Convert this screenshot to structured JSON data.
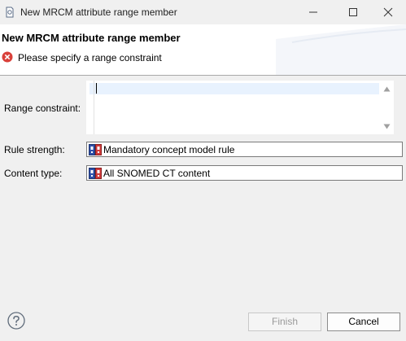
{
  "window": {
    "title": "New MRCM attribute range member",
    "controls": [
      "minimize-icon",
      "maximize-icon",
      "close-icon"
    ]
  },
  "header": {
    "title": "New MRCM attribute range member",
    "message": "Please specify a range constraint",
    "message_icon": "error-icon"
  },
  "form": {
    "range_label": "Range constraint:",
    "range_value": "",
    "strength_label": "Rule strength:",
    "strength_value": "Mandatory concept model rule",
    "content_label": "Content type:",
    "content_value": "All SNOMED CT content",
    "value_icon": "refset-icon"
  },
  "footer": {
    "help_icon": "help-icon",
    "finish_label": "Finish",
    "finish_enabled": false,
    "cancel_label": "Cancel"
  },
  "colors": {
    "background": "#f0f0f0",
    "header_background": "#ffffff",
    "error_red": "#d9403a",
    "icon_blue": "#2f4fa8",
    "icon_red": "#d13b3b",
    "selection_line": "#e8f2fe"
  }
}
